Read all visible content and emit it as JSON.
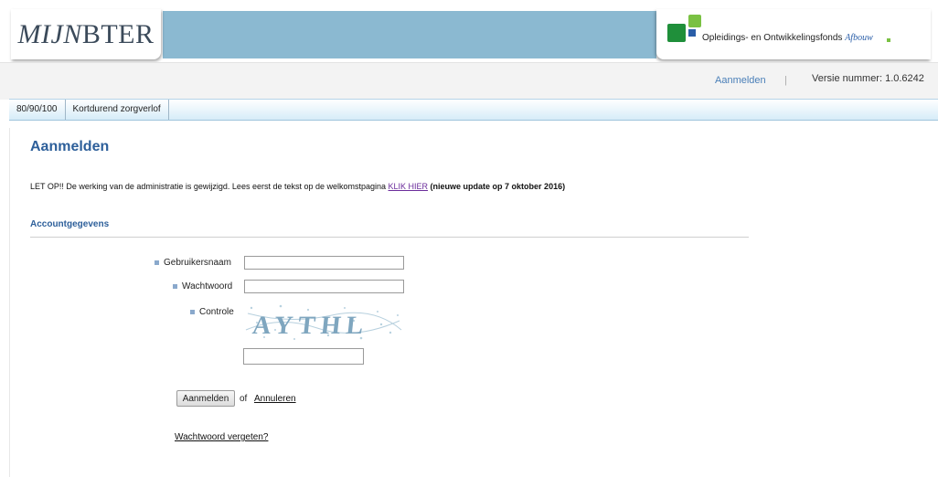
{
  "header": {
    "app_title_italic": "MIJN",
    "app_title_rest": "BTER",
    "org_name": "Opleidings- en Ontwikkelingsfonds",
    "org_name_italic": "Afbouw",
    "brand_colors": {
      "green_dark": "#1f8f3a",
      "green_light": "#7ac143",
      "blue": "#2a5ea8",
      "band": "#8bb9d1"
    }
  },
  "statusbar": {
    "login_link": "Aanmelden",
    "separator": "|",
    "version": "Versie nummer: 1.0.6242"
  },
  "nav": {
    "items": [
      {
        "label": "80/90/100"
      },
      {
        "label": "Kortdurend zorgverlof"
      }
    ]
  },
  "main": {
    "page_title": "Aanmelden",
    "notice": {
      "text": "LET OP!! De werking van de administratie is gewijzigd. Lees eerst de tekst op de welkomstpagina ",
      "link": "KLIK HIER",
      "bold": " (nieuwe update op 7 oktober 2016)"
    },
    "section_title": "Accountgegevens",
    "form": {
      "username_label": "Gebruikersnaam",
      "username_value": "",
      "password_label": "Wachtwoord",
      "password_value": "",
      "captcha_label": "Controle",
      "captcha_text": "AYTHL",
      "captcha_value": ""
    },
    "actions": {
      "submit_label": "Aanmelden",
      "or_text": "of",
      "cancel_label": "Annuleren",
      "forgot_label": "Wachtwoord vergeten?"
    }
  }
}
